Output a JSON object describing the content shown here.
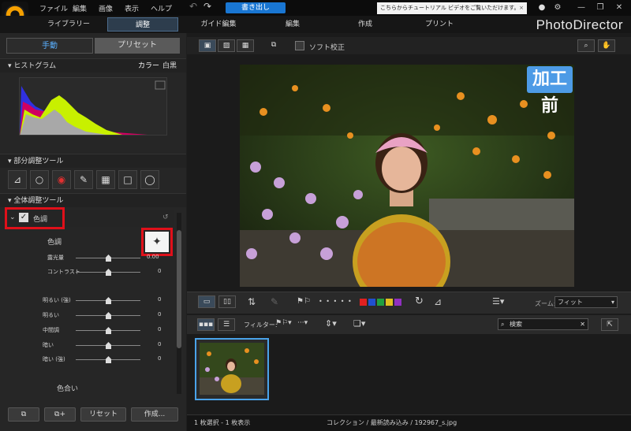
{
  "menu": [
    "ファイル",
    "編集",
    "画像",
    "表示",
    "ヘルプ"
  ],
  "write_out": "書き出し",
  "tutorial_banner": "こちらからチュートリアル ビデオをご覧いただけます。",
  "tutorial_close": "×",
  "window_controls": [
    "—",
    "❐",
    "✕"
  ],
  "modules": [
    "ライブラリー",
    "調整",
    "ガイド編集",
    "編集",
    "作成",
    "プリント"
  ],
  "brand": "PhotoDirector",
  "left_tabs": {
    "manual": "手動",
    "preset": "プリセット"
  },
  "histogram": {
    "label": "ヒストグラム",
    "color": "カラー",
    "mono": "白黒"
  },
  "regional_tools": {
    "label": "部分調整ツール",
    "icons": [
      "crop-icon",
      "spot-removal-icon",
      "red-eye-icon",
      "brush-icon",
      "gradient-icon",
      "square-mask-icon",
      "radial-icon"
    ]
  },
  "global_tools": {
    "label": "全体調整ツール"
  },
  "tone": {
    "section_label": "色調",
    "sub_label": "色調",
    "sliders": [
      {
        "label": "露光量",
        "value": "0.00",
        "pos": 0.5
      },
      {
        "label": "コントラスト",
        "value": "0",
        "pos": 0.5
      }
    ],
    "tone_sliders": [
      {
        "label": "明るい (強)",
        "value": "0",
        "pos": 0.5
      },
      {
        "label": "明るい",
        "value": "0",
        "pos": 0.5
      },
      {
        "label": "中間調",
        "value": "0",
        "pos": 0.5
      },
      {
        "label": "暗い",
        "value": "0",
        "pos": 0.5
      },
      {
        "label": "暗い (強)",
        "value": "0",
        "pos": 0.5
      }
    ],
    "color_label": "色合い"
  },
  "bottom_buttons": [
    "リセット",
    "作成..."
  ],
  "view": {
    "soft_proof": "ソフト校正"
  },
  "photo_tag": "加工前",
  "edit_bar": {
    "zoom_label": "ズーム:",
    "zoom_value": "フィット",
    "dots": "• • • • •",
    "colors": [
      "#e02020",
      "#2050d0",
      "#20a040",
      "#e0c020",
      "#9030c0"
    ]
  },
  "filter_bar": {
    "filter_label": "フィルター:",
    "search_placeholder": "検索"
  },
  "status": {
    "selection": "1 枚選択 - 1 枚表示",
    "path": "コレクション / 最新読み込み / 192967_s.jpg"
  },
  "accent": "#1976d2"
}
